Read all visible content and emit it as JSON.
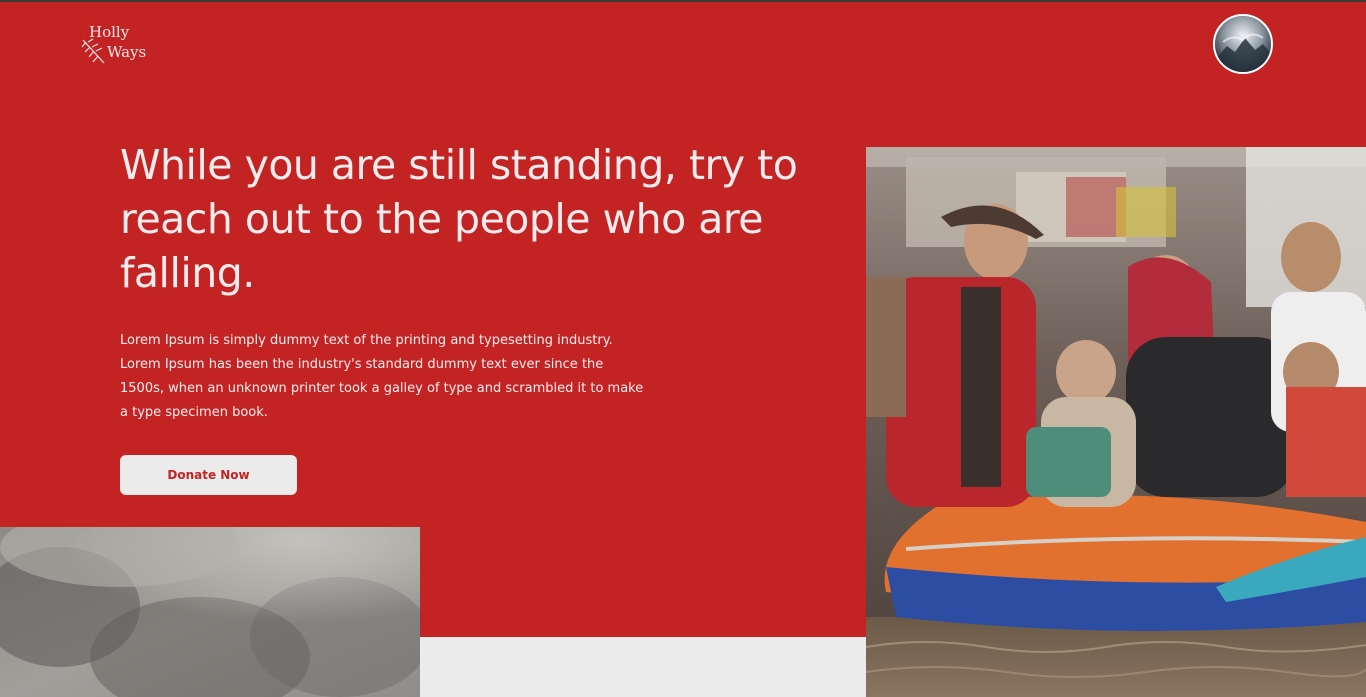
{
  "logo": {
    "line1": "Holly",
    "line2": "Ways"
  },
  "profile": {
    "icon": "avatar-icon"
  },
  "hero": {
    "headline": "While you are still standing, try to reach out to the people who are falling.",
    "body": "Lorem Ipsum is simply dummy text of the printing and typesetting industry. Lorem Ipsum has been the industry's standard dummy text ever since the 1500s, when an unknown printer took a galley of type and scrambled it to make a type specimen book.",
    "donate_label": "Donate Now"
  },
  "colors": {
    "brand_red": "#c42324",
    "light_gray": "#ebebeb",
    "text_light": "#f4ecec"
  }
}
